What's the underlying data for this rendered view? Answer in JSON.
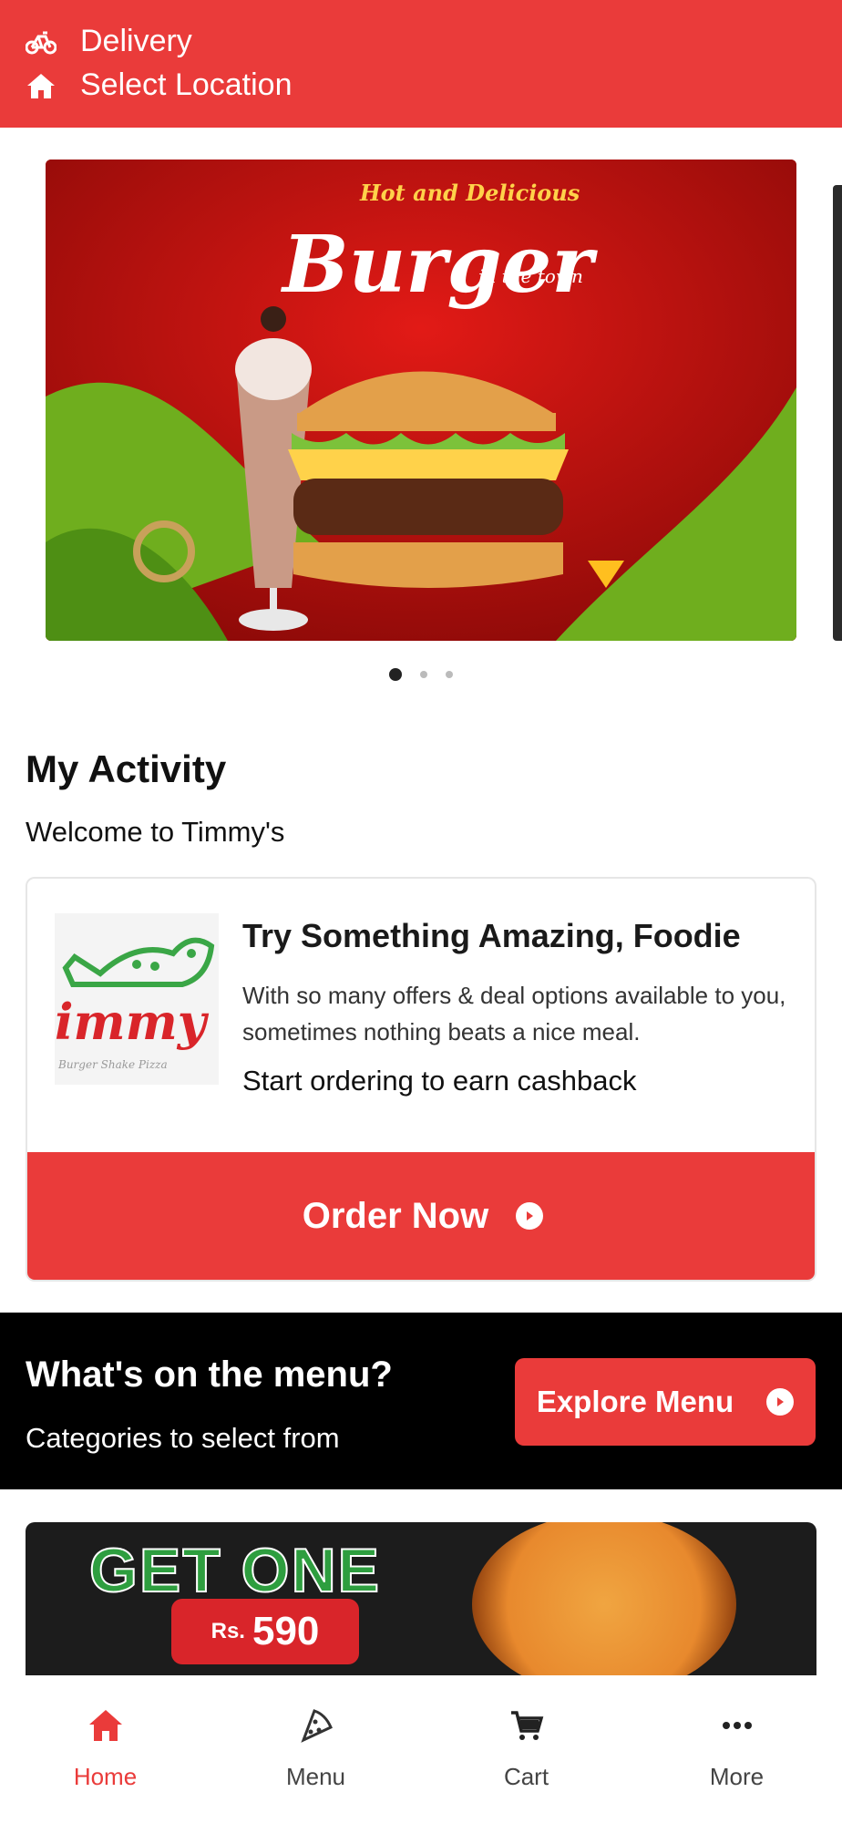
{
  "header": {
    "mode_label": "Delivery",
    "location_label": "Select Location"
  },
  "carousel": {
    "banner_tagline": "Hot and Delicious",
    "banner_title": "Burger",
    "banner_subtitle": "in the town",
    "slide_count": 3,
    "active_slide": 1
  },
  "activity": {
    "title": "My Activity",
    "subtitle": "Welcome to Timmy's",
    "card": {
      "logo_text": "immy",
      "logo_tagline": "Burger Shake Pizza",
      "title": "Try Something Amazing, Foodie",
      "description": "With so many offers & deal options available to you, sometimes nothing beats a nice meal.",
      "cashback_text": "Start ordering to earn cashback",
      "button_label": "Order Now"
    }
  },
  "menu_banner": {
    "title": "What's on the menu?",
    "subtitle": "Categories to select from",
    "button_label": "Explore Menu"
  },
  "promo": {
    "title": "GET ONE",
    "price_currency": "Rs.",
    "price_value": "590"
  },
  "bottom_nav": {
    "items": [
      {
        "label": "Home",
        "icon": "home-icon",
        "active": true
      },
      {
        "label": "Menu",
        "icon": "pizza-slice-icon",
        "active": false
      },
      {
        "label": "Cart",
        "icon": "cart-icon",
        "active": false
      },
      {
        "label": "More",
        "icon": "more-dots-icon",
        "active": false
      }
    ]
  },
  "colors": {
    "brand_red": "#ea3b3a",
    "dark": "#000000",
    "logo_green": "#3aa646"
  }
}
